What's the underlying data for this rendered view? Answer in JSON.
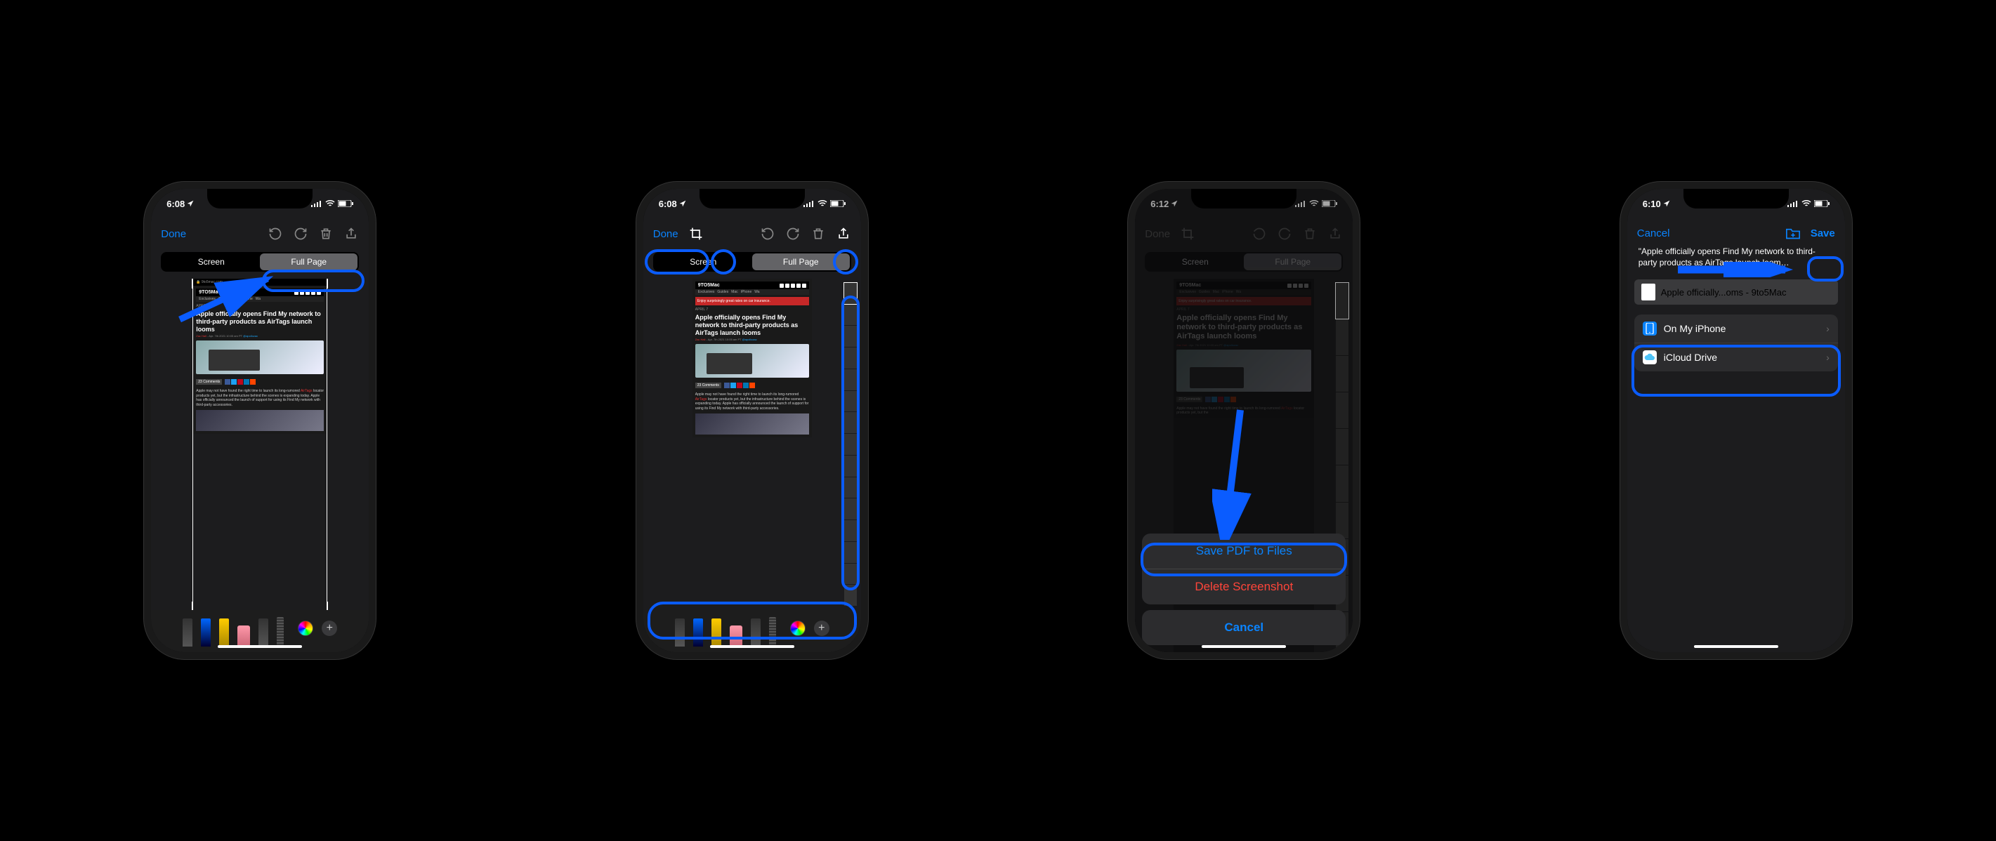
{
  "phone1": {
    "time": "6:08",
    "done": "Done",
    "seg_screen": "Screen",
    "seg_fullpage": "Full Page",
    "article": {
      "site": "9TO5Mac",
      "nav": [
        "Exclusives",
        "Guides",
        "Mac",
        "iPhone",
        "Wa"
      ],
      "date": "APRIL 7",
      "headline": "Apple officially opens Find My network to third-party products as AirTags launch looms",
      "byline_author": "Zac Hall",
      "byline_date": "- Apr. 7th 2021 10:05 am PT",
      "byline_tw": "@apollozac",
      "comments": "23 Comments",
      "body": "Apple may not have found the right time to launch its long-rumored AirTags locator products yet, but the infrastructure behind the scenes is expanding today. Apple has officially announced the launch of support for using its Find My network with third-party accessories.",
      "ad": "Enjoy surprisingly great rates on car insurance."
    }
  },
  "phone2": {
    "time": "6:08",
    "done": "Done",
    "seg_screen": "Screen",
    "seg_fullpage": "Full Page"
  },
  "phone3": {
    "time": "6:12",
    "done": "Done",
    "seg_screen": "Screen",
    "seg_fullpage": "Full Page",
    "save_pdf": "Save PDF to Files",
    "delete": "Delete Screenshot",
    "cancel": "Cancel"
  },
  "phone4": {
    "time": "6:10",
    "cancel": "Cancel",
    "save": "Save",
    "quote": "\"Apple officially opens Find My network to third-party products as AirTags launch loom…",
    "filename": "Apple officially...oms - 9to5Mac",
    "loc1": "On My iPhone",
    "loc2": "iCloud Drive"
  }
}
